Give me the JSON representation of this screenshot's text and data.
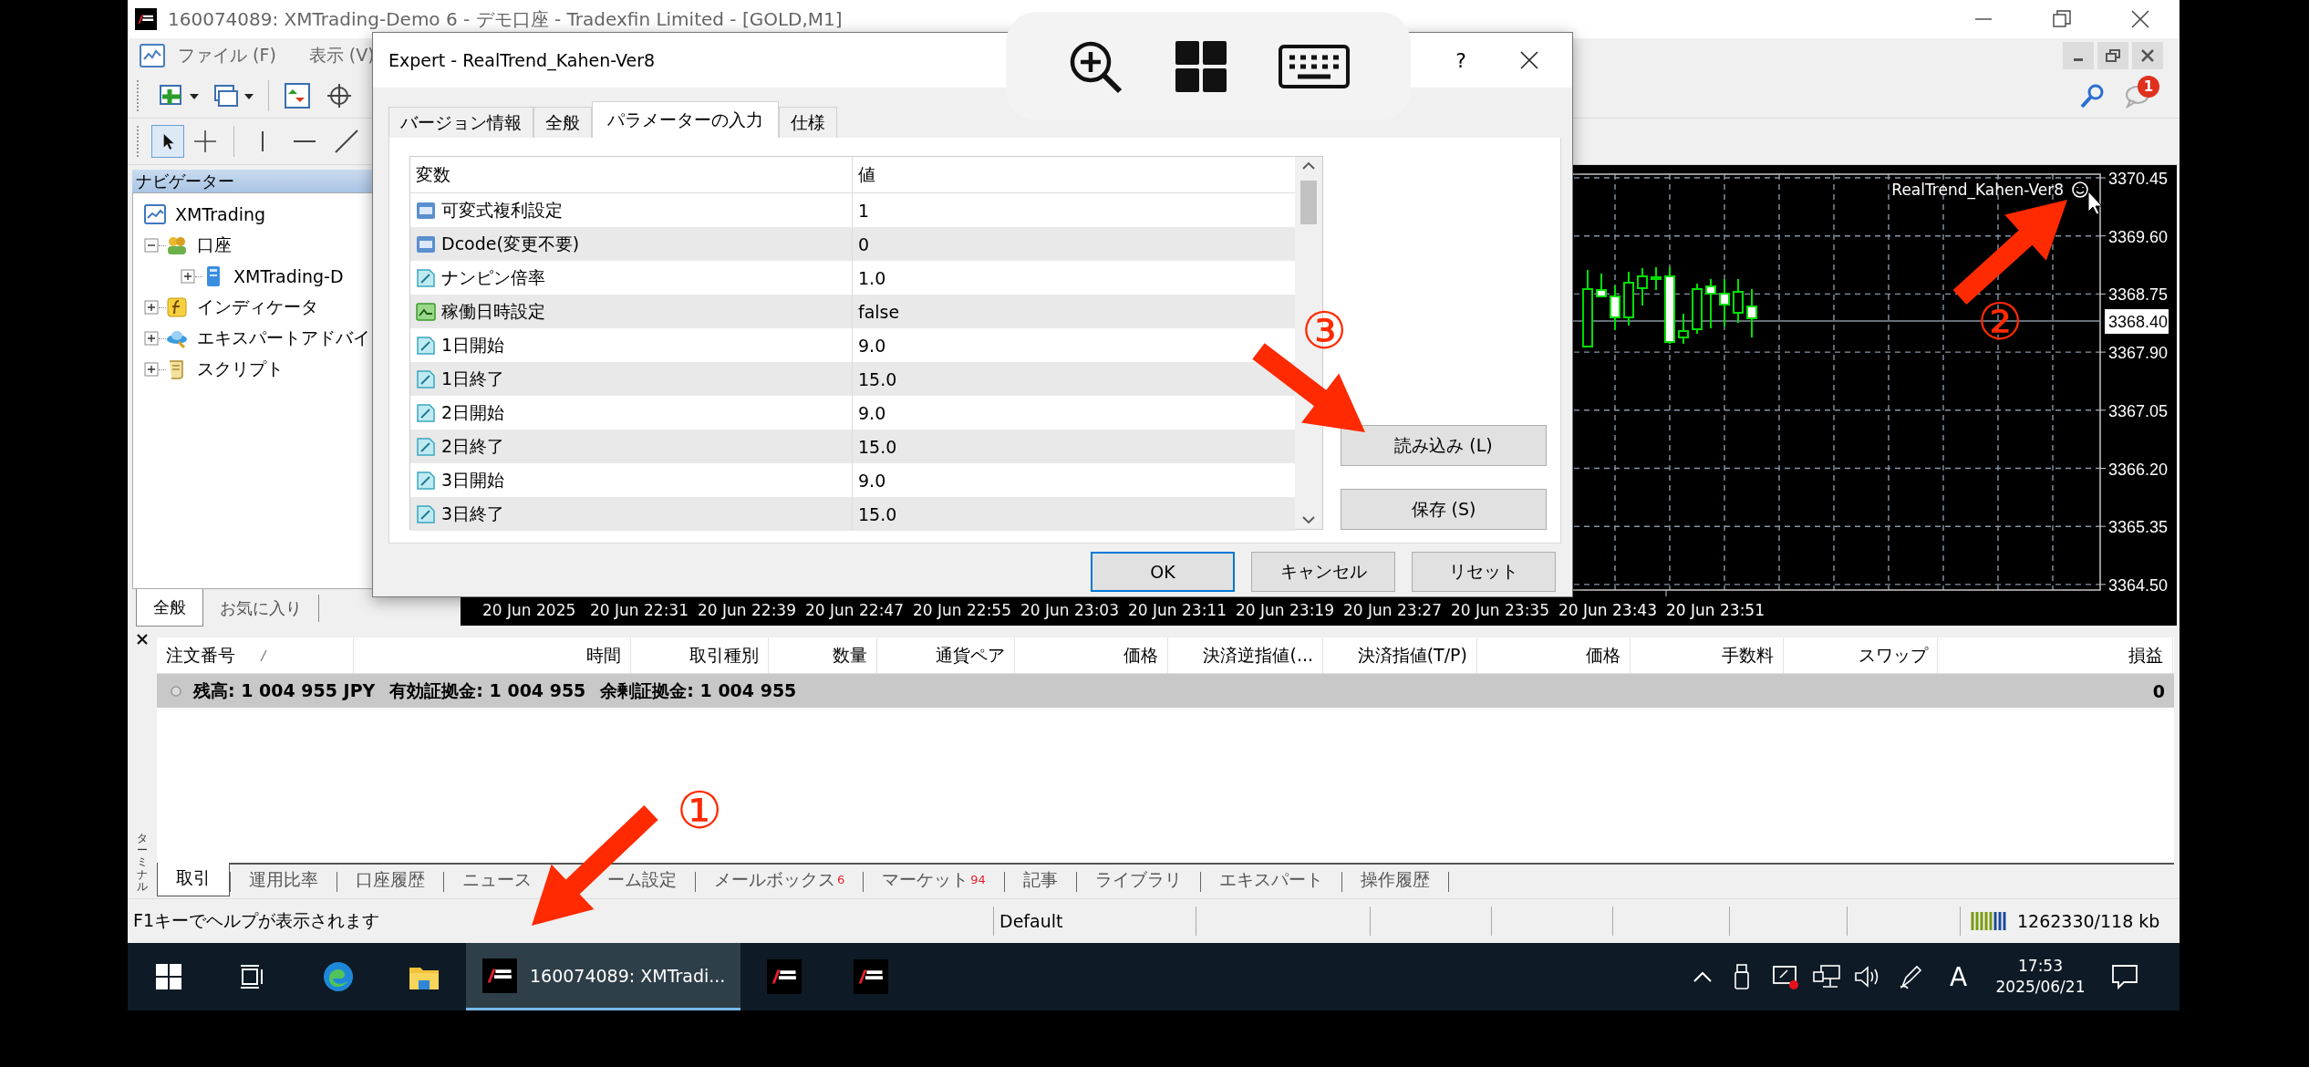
{
  "window": {
    "title": "160074089: XMTrading-Demo 6 - デモ口座 - Tradexfin Limited - [GOLD,M1]"
  },
  "menu": [
    "ファイル (F)",
    "表示 (V)"
  ],
  "notification_badge": "1",
  "navigator": {
    "title": "ナビゲーター",
    "tree": [
      {
        "label": "XMTrading",
        "kind": "root",
        "children": [
          {
            "label": "口座",
            "kind": "accounts",
            "expanded": true,
            "children": [
              {
                "label": "XMTrading-D",
                "kind": "server",
                "expanded": false
              }
            ]
          },
          {
            "label": "インディケータ",
            "kind": "indicators",
            "expanded": false
          },
          {
            "label": "エキスパートアドバイ",
            "kind": "experts",
            "expanded": false
          },
          {
            "label": "スクリプト",
            "kind": "scripts",
            "expanded": false
          }
        ]
      }
    ],
    "tabs": [
      {
        "label": "全般",
        "selected": true
      },
      {
        "label": "お気に入り",
        "selected": false
      }
    ]
  },
  "chart": {
    "expert_label": "RealTrend_Kahen-Ver8",
    "price_ticks": [
      "3370.45",
      "3369.60",
      "3368.75",
      "3367.90",
      "3367.05",
      "3366.20",
      "3365.35",
      "3364.50"
    ],
    "current_price": "3368.40",
    "time_ticks": [
      "20 Jun 2025",
      "20 Jun 22:31",
      "20 Jun 22:39",
      "20 Jun 22:47",
      "20 Jun 22:55",
      "20 Jun 23:03",
      "20 Jun 23:11",
      "20 Jun 23:19",
      "20 Jun 23:27",
      "20 Jun 23:35",
      "20 Jun 23:43",
      "20 Jun 23:51"
    ]
  },
  "dialog": {
    "title": "Expert - RealTrend_Kahen-Ver8",
    "help": "?",
    "tabs": [
      {
        "label": "バージョン情報",
        "selected": false
      },
      {
        "label": "全般",
        "selected": false
      },
      {
        "label": "パラメーターの入力",
        "selected": true
      },
      {
        "label": "仕様",
        "selected": false
      }
    ],
    "columns": [
      "変数",
      "値"
    ],
    "rows": [
      {
        "kind": "int",
        "name": "可変式複利設定",
        "value": "1"
      },
      {
        "kind": "int",
        "name": "Dcode(変更不要)",
        "value": "0"
      },
      {
        "kind": "double",
        "name": "ナンピン倍率",
        "value": "1.0"
      },
      {
        "kind": "bool",
        "name": "稼働日時設定",
        "value": "false"
      },
      {
        "kind": "double",
        "name": "1日開始",
        "value": "9.0"
      },
      {
        "kind": "double",
        "name": "1日終了",
        "value": "15.0"
      },
      {
        "kind": "double",
        "name": "2日開始",
        "value": "9.0"
      },
      {
        "kind": "double",
        "name": "2日終了",
        "value": "15.0"
      },
      {
        "kind": "double",
        "name": "3日開始",
        "value": "9.0"
      },
      {
        "kind": "double",
        "name": "3日終了",
        "value": "15.0"
      }
    ],
    "side_buttons": [
      "読み込み (L)",
      "保存 (S)"
    ],
    "buttons": [
      {
        "label": "OK",
        "default": true
      },
      {
        "label": "キャンセル",
        "default": false
      },
      {
        "label": "リセット",
        "default": false
      }
    ]
  },
  "terminal": {
    "side_label": "ターミナル",
    "columns": [
      "注文番号",
      "時間",
      "取引種別",
      "数量",
      "通貨ペア",
      "価格",
      "決済逆指値(...",
      "決済指値(T/P)",
      "価格",
      "手数料",
      "スワップ",
      "損益"
    ],
    "summary": {
      "items": [
        "残高: 1 004 955 JPY",
        "有効証拠金: 1 004 955",
        "余剰証拠金: 1 004 955"
      ],
      "profit": "0"
    },
    "tabs": [
      {
        "label": "取引",
        "selected": true
      },
      {
        "label": "運用比率",
        "selected": false
      },
      {
        "label": "口座履歴",
        "selected": false
      },
      {
        "label": "ニュース",
        "selected": false
      },
      {
        "label": "ーム設定",
        "selected": false
      },
      {
        "label": "メールボックス",
        "count": "6",
        "selected": false
      },
      {
        "label": "マーケット",
        "count": "94",
        "selected": false
      },
      {
        "label": "記事",
        "selected": false
      },
      {
        "label": "ライブラリ",
        "selected": false
      },
      {
        "label": "エキスパート",
        "selected": false
      },
      {
        "label": "操作履歴",
        "selected": false
      }
    ]
  },
  "status_bar": {
    "help": "F1キーでヘルプが表示されます",
    "profile": "Default",
    "traffic": "1262330/118 kb"
  },
  "taskbar": {
    "active_app": "160074089: XMTradi...",
    "ime": "A",
    "time": "17:53",
    "date": "2025/06/21"
  },
  "annotations": [
    {
      "label": "①"
    },
    {
      "label": "②"
    },
    {
      "label": "③"
    }
  ]
}
